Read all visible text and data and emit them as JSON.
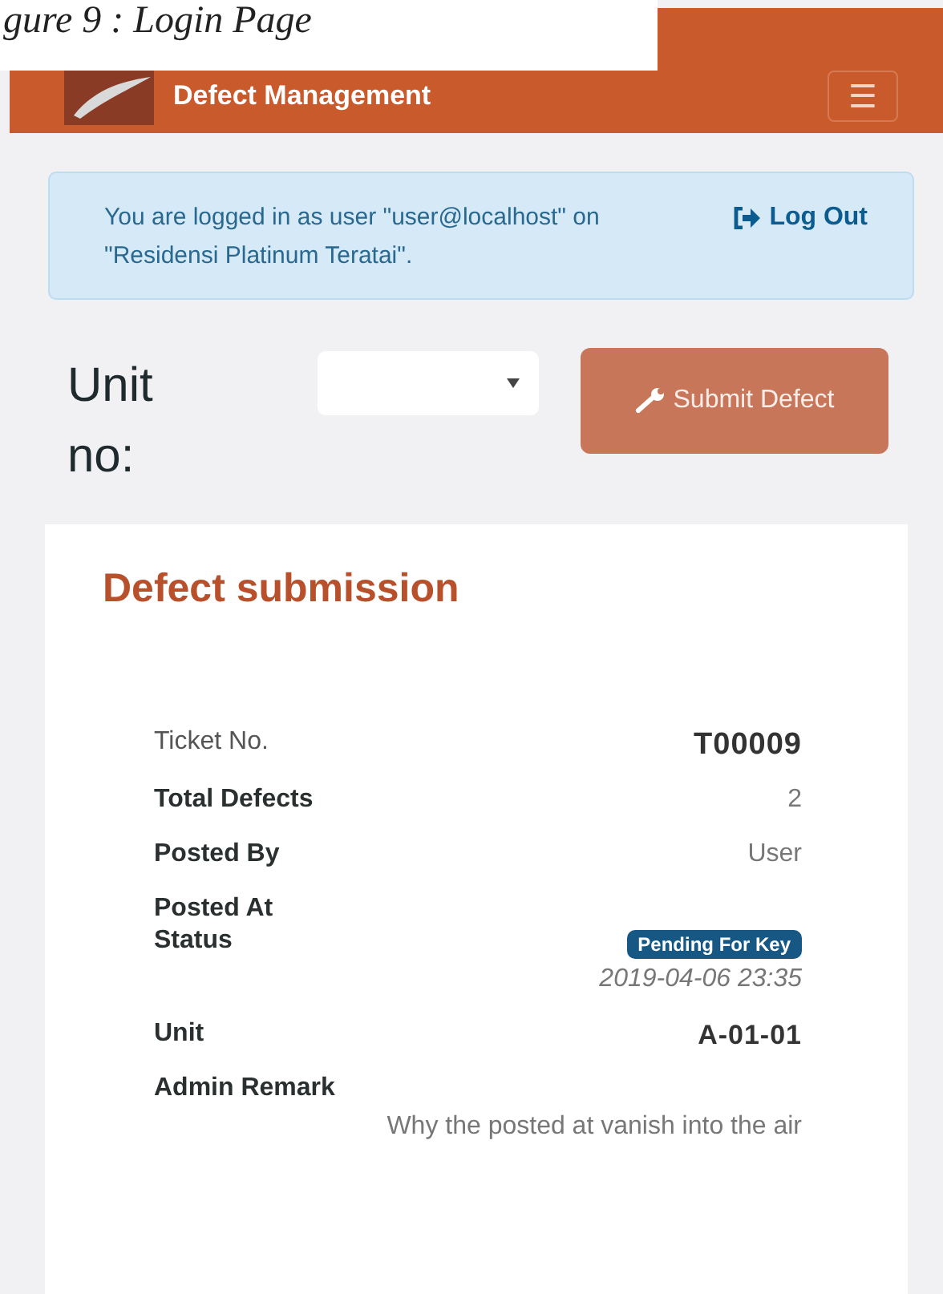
{
  "caption": "gure 9 : Login Page",
  "header": {
    "title": "Defect Management",
    "menu_icon": "☰"
  },
  "alert": {
    "message": "You are logged in as user \"user@localhost\" on \"Residensi Platinum Teratai\".",
    "link": "Log Out"
  },
  "unit_form": {
    "label": "Unit no:",
    "button": "Submit Defect"
  },
  "card": {
    "title": "Defect submission",
    "fields": [
      {
        "label": "Ticket No.",
        "value": "T00009",
        "kind": "ticket"
      },
      {
        "label": "Total Defects",
        "value": "2",
        "kind": "text"
      },
      {
        "label": "Posted By",
        "value": "User",
        "kind": "text"
      },
      {
        "label": "Posted At",
        "kind": "label"
      },
      {
        "label": "Status",
        "badge": "Pending For Key",
        "value": "2019-04-06 23:35",
        "kind": "status"
      },
      {
        "label": "Unit",
        "value": "A-01-01",
        "kind": "strong"
      },
      {
        "label": "Admin Remark",
        "value": "Why the posted at vanish into the air",
        "kind": "remark"
      }
    ]
  }
}
